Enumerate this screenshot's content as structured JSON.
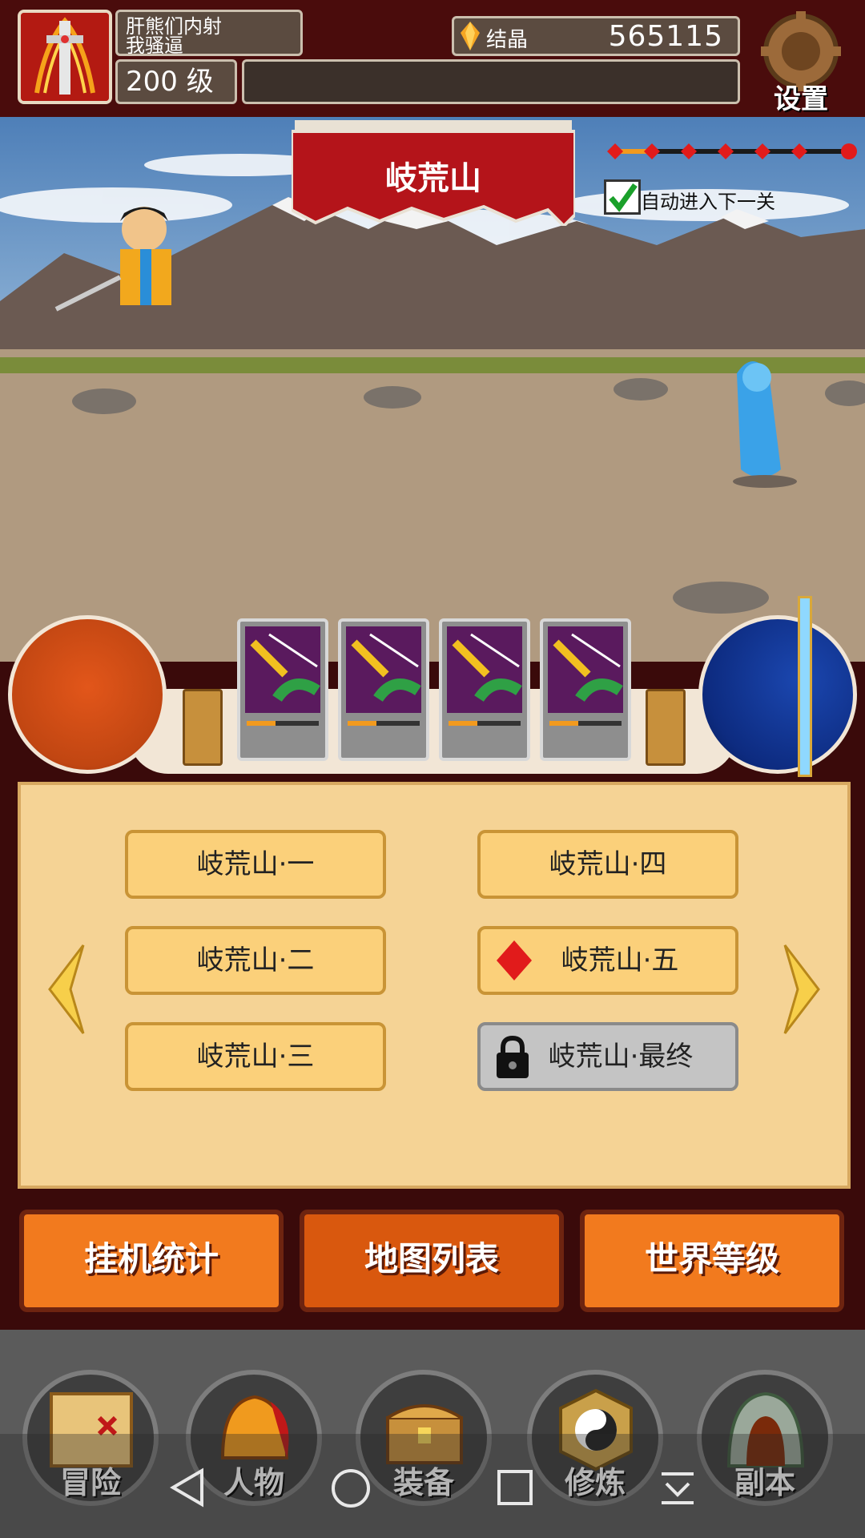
{
  "player": {
    "name": "肝熊们内射\n我骚逼",
    "level": "200 级"
  },
  "currency": {
    "label": "结晶",
    "value": "565115"
  },
  "settings": {
    "label": "设置"
  },
  "stage": {
    "title": "岐荒山",
    "auto_next_label": "自动进入下一关",
    "auto_next_checked": true
  },
  "maps": [
    {
      "label": "岐荒山·一",
      "state": "normal"
    },
    {
      "label": "岐荒山·二",
      "state": "normal"
    },
    {
      "label": "岐荒山·三",
      "state": "normal"
    },
    {
      "label": "岐荒山·四",
      "state": "normal"
    },
    {
      "label": "岐荒山·五",
      "state": "current"
    },
    {
      "label": "岐荒山·最终",
      "state": "locked"
    }
  ],
  "tabs": [
    {
      "label": "挂机统计"
    },
    {
      "label": "地图列表"
    },
    {
      "label": "世界等级"
    }
  ],
  "nav": [
    {
      "label": "冒险",
      "icon": "map-icon"
    },
    {
      "label": "人物",
      "icon": "helmet-icon"
    },
    {
      "label": "装备",
      "icon": "chest-icon"
    },
    {
      "label": "修炼",
      "icon": "yin-yang-icon"
    },
    {
      "label": "副本",
      "icon": "cave-icon"
    }
  ],
  "colors": {
    "accent": "#f27a1e",
    "brand": "#4a0c0c",
    "parchment": "#f5d395"
  }
}
